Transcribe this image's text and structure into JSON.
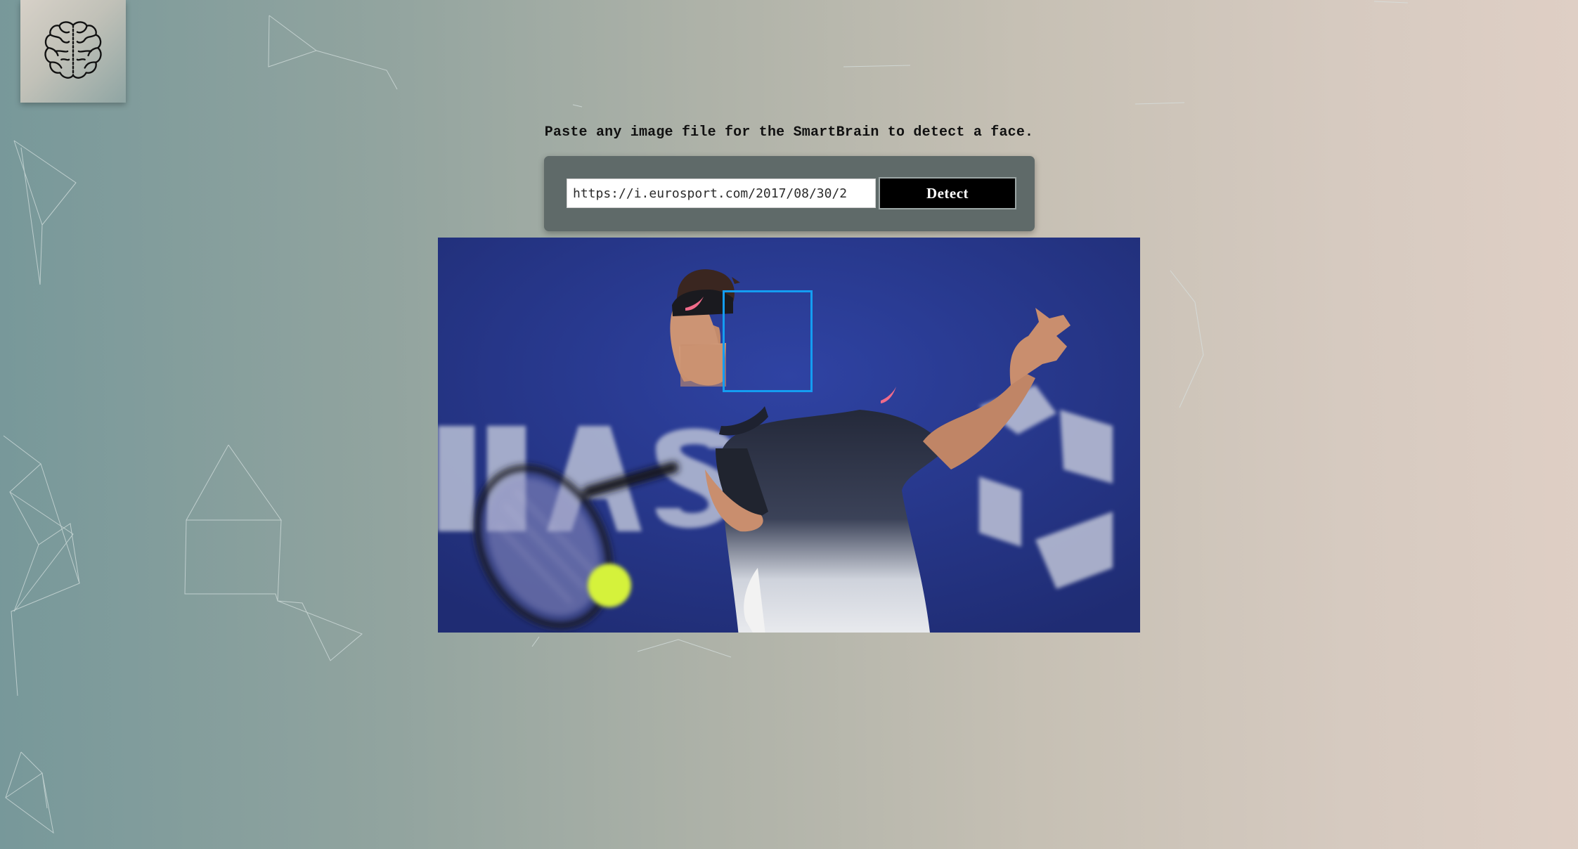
{
  "app": {
    "logo_icon": "brain-icon"
  },
  "instruction": {
    "text": "Paste any image file for the SmartBrain to detect a face."
  },
  "form": {
    "url_value": "https://i.eurosport.com/2017/08/30/2",
    "detect_label": "Detect"
  },
  "result": {
    "image_subject": "tennis-player-forehand",
    "faces_detected": 1,
    "box_color": "#149df2"
  },
  "colors": {
    "background_left": "#77989a",
    "background_right": "#dfcfc5",
    "panel": "#5f6a69",
    "button": "#000000",
    "court_blue": "#27378a"
  }
}
